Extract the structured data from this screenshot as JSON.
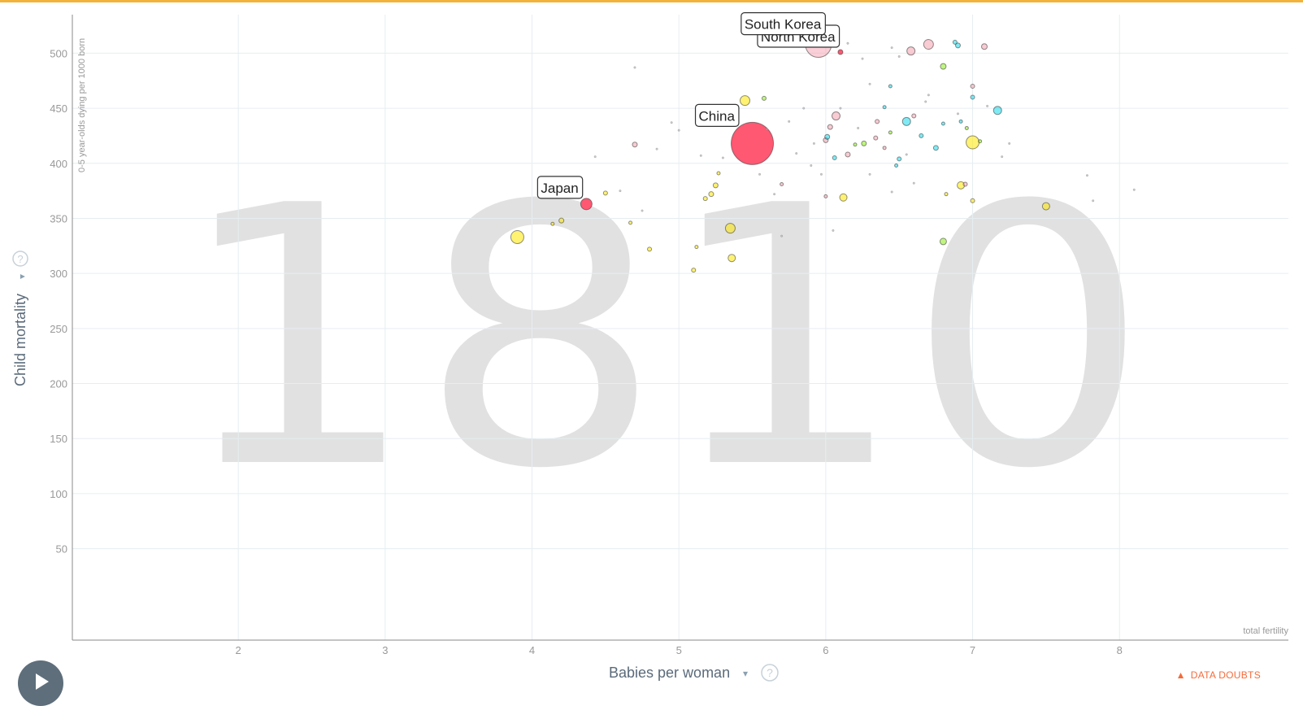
{
  "top_bar_color": "#f3b33a",
  "year_watermark": "1810",
  "x_axis": {
    "title": "Babies per woman",
    "caret": "▾",
    "help_icon": "?",
    "corner_label": "total fertility"
  },
  "y_axis": {
    "title": "Child mortality",
    "caret": "▾",
    "help_icon": "?",
    "subtitle": "0-5 year-olds dying per 1000 born"
  },
  "data_doubts": {
    "icon": "warning-icon",
    "label": "DATA DOUBTS"
  },
  "play_button": {
    "icon": "play-icon"
  },
  "colors": {
    "asia": "#ff5872",
    "asia_light": "#f5a8b6",
    "africa": "#00d5e9",
    "americas": "#7feb00",
    "europe": "#ffe700",
    "small": "#b0b0b0",
    "grid": "#e6eef0",
    "watermark": "#e1e1e1"
  },
  "chart_data": {
    "type": "scatter",
    "x_label": "Babies per woman",
    "y_label": "Child mortality",
    "y_sublabel": "0-5 year-olds dying per 1000 born",
    "x_corner_label": "total fertility",
    "x_ticks": [
      2,
      3,
      4,
      5,
      6,
      7,
      8
    ],
    "y_ticks": [
      50,
      100,
      150,
      200,
      250,
      300,
      350,
      400,
      450,
      500
    ],
    "xlim": [
      0.87,
      9.15
    ],
    "ylim": [
      -33,
      535
    ],
    "grid": true,
    "labeled_points": [
      {
        "label": "China",
        "x": 5.5,
        "y": 418
      },
      {
        "label": "Japan",
        "x": 4.37,
        "y": 363
      },
      {
        "label": "North Korea",
        "x": 6.1,
        "y": 501
      },
      {
        "label": "South Korea",
        "x": 5.95,
        "y": 505
      }
    ],
    "points": [
      {
        "x": 5.5,
        "y": 418,
        "r": 26,
        "c": "asia",
        "a": 1
      },
      {
        "x": 5.95,
        "y": 508,
        "r": 16,
        "c": "asia_light",
        "a": 0.55
      },
      {
        "x": 6.1,
        "y": 501,
        "r": 3,
        "c": "asia",
        "a": 1
      },
      {
        "x": 4.37,
        "y": 363,
        "r": 7,
        "c": "asia",
        "a": 1
      },
      {
        "x": 3.9,
        "y": 333,
        "r": 8,
        "c": "europe",
        "a": 0.55
      },
      {
        "x": 4.2,
        "y": 348,
        "r": 3,
        "c": "europe",
        "a": 0.55
      },
      {
        "x": 4.14,
        "y": 345,
        "r": 2,
        "c": "europe",
        "a": 0.55
      },
      {
        "x": 4.5,
        "y": 373,
        "r": 2.5,
        "c": "europe",
        "a": 0.55
      },
      {
        "x": 5.45,
        "y": 457,
        "r": 6,
        "c": "europe",
        "a": 0.55
      },
      {
        "x": 5.35,
        "y": 341,
        "r": 6,
        "c": "europe",
        "a": 0.55
      },
      {
        "x": 5.36,
        "y": 314,
        "r": 4.5,
        "c": "europe",
        "a": 0.55
      },
      {
        "x": 5.22,
        "y": 372,
        "r": 3,
        "c": "europe",
        "a": 0.55
      },
      {
        "x": 5.25,
        "y": 380,
        "r": 3,
        "c": "europe",
        "a": 0.55
      },
      {
        "x": 5.18,
        "y": 368,
        "r": 2.5,
        "c": "europe",
        "a": 0.55
      },
      {
        "x": 5.1,
        "y": 303,
        "r": 2.5,
        "c": "europe",
        "a": 0.55
      },
      {
        "x": 4.8,
        "y": 322,
        "r": 2.5,
        "c": "europe",
        "a": 0.55
      },
      {
        "x": 4.67,
        "y": 346,
        "r": 2,
        "c": "europe",
        "a": 0.55
      },
      {
        "x": 5.12,
        "y": 324,
        "r": 2,
        "c": "europe",
        "a": 0.55
      },
      {
        "x": 5.27,
        "y": 391,
        "r": 2,
        "c": "europe",
        "a": 0.55
      },
      {
        "x": 6.12,
        "y": 369,
        "r": 4.5,
        "c": "europe",
        "a": 0.55
      },
      {
        "x": 7.0,
        "y": 419,
        "r": 8,
        "c": "europe",
        "a": 0.55
      },
      {
        "x": 6.92,
        "y": 380,
        "r": 4.5,
        "c": "europe",
        "a": 0.55
      },
      {
        "x": 7.5,
        "y": 361,
        "r": 4.5,
        "c": "europe",
        "a": 0.55
      },
      {
        "x": 7.0,
        "y": 366,
        "r": 2.5,
        "c": "europe",
        "a": 0.55
      },
      {
        "x": 6.82,
        "y": 372,
        "r": 2,
        "c": "europe",
        "a": 0.55
      },
      {
        "x": 6.95,
        "y": 381,
        "r": 2.5,
        "c": "asia_light",
        "a": 0.6
      },
      {
        "x": 6.7,
        "y": 508,
        "r": 6,
        "c": "asia_light",
        "a": 0.6
      },
      {
        "x": 6.58,
        "y": 502,
        "r": 5,
        "c": "asia_light",
        "a": 0.6
      },
      {
        "x": 7.08,
        "y": 506,
        "r": 3.5,
        "c": "asia_light",
        "a": 0.6
      },
      {
        "x": 6.07,
        "y": 443,
        "r": 5,
        "c": "asia_light",
        "a": 0.6
      },
      {
        "x": 6.03,
        "y": 433,
        "r": 3,
        "c": "asia_light",
        "a": 0.6
      },
      {
        "x": 6.0,
        "y": 421,
        "r": 3,
        "c": "asia_light",
        "a": 0.6
      },
      {
        "x": 6.15,
        "y": 408,
        "r": 3,
        "c": "asia_light",
        "a": 0.6
      },
      {
        "x": 6.35,
        "y": 438,
        "r": 2.5,
        "c": "asia_light",
        "a": 0.6
      },
      {
        "x": 6.34,
        "y": 423,
        "r": 2.5,
        "c": "asia_light",
        "a": 0.6
      },
      {
        "x": 6.0,
        "y": 370,
        "r": 2,
        "c": "asia_light",
        "a": 0.6
      },
      {
        "x": 5.7,
        "y": 381,
        "r": 2,
        "c": "asia_light",
        "a": 0.6
      },
      {
        "x": 4.7,
        "y": 417,
        "r": 3,
        "c": "asia_light",
        "a": 0.6
      },
      {
        "x": 7.0,
        "y": 470,
        "r": 2.5,
        "c": "asia_light",
        "a": 0.6
      },
      {
        "x": 6.6,
        "y": 443,
        "r": 2.5,
        "c": "asia_light",
        "a": 0.6
      },
      {
        "x": 6.4,
        "y": 414,
        "r": 2,
        "c": "asia_light",
        "a": 0.6
      },
      {
        "x": 6.55,
        "y": 438,
        "r": 5,
        "c": "africa",
        "a": 0.5
      },
      {
        "x": 7.17,
        "y": 448,
        "r": 5,
        "c": "africa",
        "a": 0.5
      },
      {
        "x": 6.01,
        "y": 424,
        "r": 3,
        "c": "africa",
        "a": 0.5
      },
      {
        "x": 6.06,
        "y": 405,
        "r": 2.5,
        "c": "africa",
        "a": 0.5
      },
      {
        "x": 6.75,
        "y": 414,
        "r": 3,
        "c": "africa",
        "a": 0.5
      },
      {
        "x": 6.65,
        "y": 425,
        "r": 2.5,
        "c": "africa",
        "a": 0.5
      },
      {
        "x": 6.9,
        "y": 507,
        "r": 3,
        "c": "africa",
        "a": 0.5
      },
      {
        "x": 6.88,
        "y": 510,
        "r": 2.5,
        "c": "africa",
        "a": 0.5
      },
      {
        "x": 7.0,
        "y": 460,
        "r": 2.5,
        "c": "africa",
        "a": 0.5
      },
      {
        "x": 6.44,
        "y": 470,
        "r": 2,
        "c": "africa",
        "a": 0.5
      },
      {
        "x": 6.92,
        "y": 438,
        "r": 2,
        "c": "africa",
        "a": 0.5
      },
      {
        "x": 6.5,
        "y": 404,
        "r": 2.5,
        "c": "africa",
        "a": 0.5
      },
      {
        "x": 6.48,
        "y": 398,
        "r": 2,
        "c": "africa",
        "a": 0.5
      },
      {
        "x": 6.8,
        "y": 436,
        "r": 2,
        "c": "africa",
        "a": 0.5
      },
      {
        "x": 6.4,
        "y": 451,
        "r": 2,
        "c": "africa",
        "a": 0.5
      },
      {
        "x": 6.8,
        "y": 329,
        "r": 4,
        "c": "americas",
        "a": 0.5
      },
      {
        "x": 6.8,
        "y": 488,
        "r": 3.5,
        "c": "americas",
        "a": 0.5
      },
      {
        "x": 6.26,
        "y": 418,
        "r": 3,
        "c": "americas",
        "a": 0.5
      },
      {
        "x": 6.44,
        "y": 428,
        "r": 2,
        "c": "americas",
        "a": 0.5
      },
      {
        "x": 6.2,
        "y": 417,
        "r": 2,
        "c": "americas",
        "a": 0.5
      },
      {
        "x": 7.05,
        "y": 420,
        "r": 2,
        "c": "americas",
        "a": 0.5
      },
      {
        "x": 6.96,
        "y": 432,
        "r": 2,
        "c": "americas",
        "a": 0.5
      },
      {
        "x": 5.58,
        "y": 459,
        "r": 2.5,
        "c": "americas",
        "a": 0.5
      },
      {
        "x": 4.7,
        "y": 487,
        "r": 1.3,
        "c": "small",
        "a": 0.7
      },
      {
        "x": 4.43,
        "y": 406,
        "r": 1.3,
        "c": "small",
        "a": 0.7
      },
      {
        "x": 4.6,
        "y": 375,
        "r": 1.3,
        "c": "small",
        "a": 0.7
      },
      {
        "x": 4.75,
        "y": 357,
        "r": 1.3,
        "c": "small",
        "a": 0.7
      },
      {
        "x": 4.85,
        "y": 413,
        "r": 1.3,
        "c": "small",
        "a": 0.7
      },
      {
        "x": 4.95,
        "y": 437,
        "r": 1.3,
        "c": "small",
        "a": 0.7
      },
      {
        "x": 5.0,
        "y": 430,
        "r": 1.3,
        "c": "small",
        "a": 0.7
      },
      {
        "x": 5.15,
        "y": 407,
        "r": 1.3,
        "c": "small",
        "a": 0.7
      },
      {
        "x": 5.3,
        "y": 405,
        "r": 1.3,
        "c": "small",
        "a": 0.7
      },
      {
        "x": 5.6,
        "y": 431,
        "r": 1.3,
        "c": "small",
        "a": 0.7
      },
      {
        "x": 5.75,
        "y": 438,
        "r": 1.3,
        "c": "small",
        "a": 0.7
      },
      {
        "x": 5.85,
        "y": 450,
        "r": 1.3,
        "c": "small",
        "a": 0.7
      },
      {
        "x": 5.9,
        "y": 398,
        "r": 1.3,
        "c": "small",
        "a": 0.7
      },
      {
        "x": 5.97,
        "y": 390,
        "r": 1.3,
        "c": "small",
        "a": 0.7
      },
      {
        "x": 6.05,
        "y": 339,
        "r": 1.3,
        "c": "small",
        "a": 0.7
      },
      {
        "x": 5.7,
        "y": 334,
        "r": 1.3,
        "c": "small",
        "a": 0.7
      },
      {
        "x": 6.15,
        "y": 509,
        "r": 1.3,
        "c": "small",
        "a": 0.7
      },
      {
        "x": 6.25,
        "y": 495,
        "r": 1.3,
        "c": "small",
        "a": 0.7
      },
      {
        "x": 6.45,
        "y": 505,
        "r": 1.3,
        "c": "small",
        "a": 0.7
      },
      {
        "x": 6.5,
        "y": 497,
        "r": 1.3,
        "c": "small",
        "a": 0.7
      },
      {
        "x": 6.3,
        "y": 472,
        "r": 1.3,
        "c": "small",
        "a": 0.7
      },
      {
        "x": 6.7,
        "y": 462,
        "r": 1.3,
        "c": "small",
        "a": 0.7
      },
      {
        "x": 6.9,
        "y": 445,
        "r": 1.3,
        "c": "small",
        "a": 0.7
      },
      {
        "x": 7.1,
        "y": 452,
        "r": 1.3,
        "c": "small",
        "a": 0.7
      },
      {
        "x": 7.25,
        "y": 418,
        "r": 1.3,
        "c": "small",
        "a": 0.7
      },
      {
        "x": 7.2,
        "y": 406,
        "r": 1.3,
        "c": "small",
        "a": 0.7
      },
      {
        "x": 6.45,
        "y": 374,
        "r": 1.3,
        "c": "small",
        "a": 0.7
      },
      {
        "x": 6.6,
        "y": 382,
        "r": 1.3,
        "c": "small",
        "a": 0.7
      },
      {
        "x": 6.3,
        "y": 390,
        "r": 1.3,
        "c": "small",
        "a": 0.7
      },
      {
        "x": 7.78,
        "y": 389,
        "r": 1.3,
        "c": "small",
        "a": 0.7
      },
      {
        "x": 7.82,
        "y": 366,
        "r": 1.3,
        "c": "small",
        "a": 0.7
      },
      {
        "x": 8.1,
        "y": 376,
        "r": 1.3,
        "c": "small",
        "a": 0.7
      },
      {
        "x": 6.68,
        "y": 456,
        "r": 1.3,
        "c": "small",
        "a": 0.7
      },
      {
        "x": 6.55,
        "y": 408,
        "r": 1.3,
        "c": "small",
        "a": 0.7
      },
      {
        "x": 5.8,
        "y": 409,
        "r": 1.3,
        "c": "small",
        "a": 0.7
      },
      {
        "x": 5.92,
        "y": 418,
        "r": 1.3,
        "c": "small",
        "a": 0.7
      },
      {
        "x": 6.1,
        "y": 450,
        "r": 1.3,
        "c": "small",
        "a": 0.7
      },
      {
        "x": 6.22,
        "y": 432,
        "r": 1.3,
        "c": "small",
        "a": 0.7
      },
      {
        "x": 5.65,
        "y": 372,
        "r": 1.3,
        "c": "small",
        "a": 0.7
      },
      {
        "x": 5.55,
        "y": 390,
        "r": 1.3,
        "c": "small",
        "a": 0.7
      }
    ]
  }
}
